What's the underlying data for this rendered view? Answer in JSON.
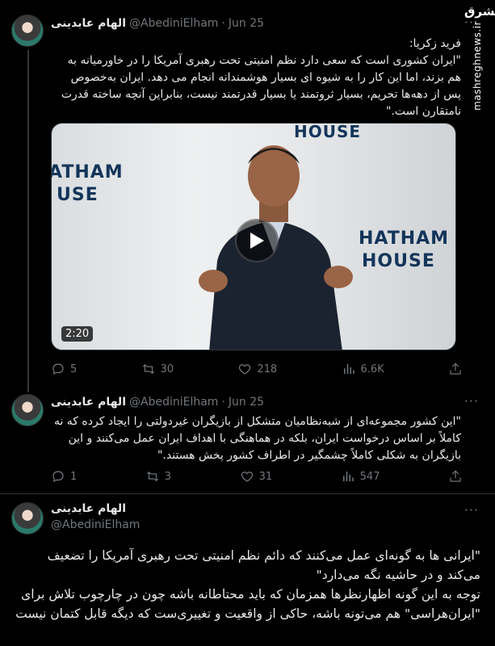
{
  "watermark": {
    "logo": "مشرق",
    "site": "mashreghnews.ir"
  },
  "tweets": [
    {
      "name": "الهام عابدینی",
      "handle": "@AbediniElham",
      "dot": "·",
      "date": "Jun 25",
      "text": "فرید زکریا:\n\"ایران کشوری است که سعی دارد نظم امنیتی تحت رهبری آمریکا را در خاورمیانه به هم بزند، اما این کار را به شیوه ای بسیار هوشمندانه انجام می دهد. ایران به‌خصوص پس از دهه‌ها تحریم، بسیار ثروتمند یا بسیار قدرتمند نیست، بنابراین آنچه ساخته قدرت نامتقارن است.\"",
      "media": {
        "wall_left_1": "ATHAM",
        "wall_left_2": "USE",
        "wall_top": "HOUSE",
        "wall_right_1": "HATHAM",
        "wall_right_2": "HOUSE",
        "duration": "2:20"
      },
      "actions": {
        "replies": "5",
        "retweets": "30",
        "likes": "218",
        "views": "6.6K"
      }
    },
    {
      "name": "الهام عابدینی",
      "handle": "@AbediniElham",
      "dot": "·",
      "date": "Jun 25",
      "text": "\"این کشور مجموعه‌ای از شبه‌نظامیان متشکل از بازیگران غیردولتی را ایجاد کرده که نه کاملاً بر اساس درخواست ایران، بلکه در هماهنگی با اهداف ایران عمل می‌کنند و این بازیگران به شکلی کاملاً چشمگیر در اطراف کشور پخش هستند.\"",
      "actions": {
        "replies": "1",
        "retweets": "3",
        "likes": "31",
        "views": "547"
      }
    },
    {
      "name": "الهام عابدینی",
      "handle": "@AbediniElham",
      "text": "\"ایرانی ها به گونه‌ای عمل می‌کنند که دائم نظم امنیتی تحت رهبری آمریکا را تضعیف می‌کند و در حاشیه نگه می‌دارد\"\nتوجه به این گونه اظهارنظرها همزمان که باید محتاطانه باشه چون در چارچوب تلاش برای \"ایران‌هراسی\" هم می‌تونه باشه، حاکی از واقعیت و تغییری‌ست که دیگه قابل کتمان نیست"
    }
  ]
}
